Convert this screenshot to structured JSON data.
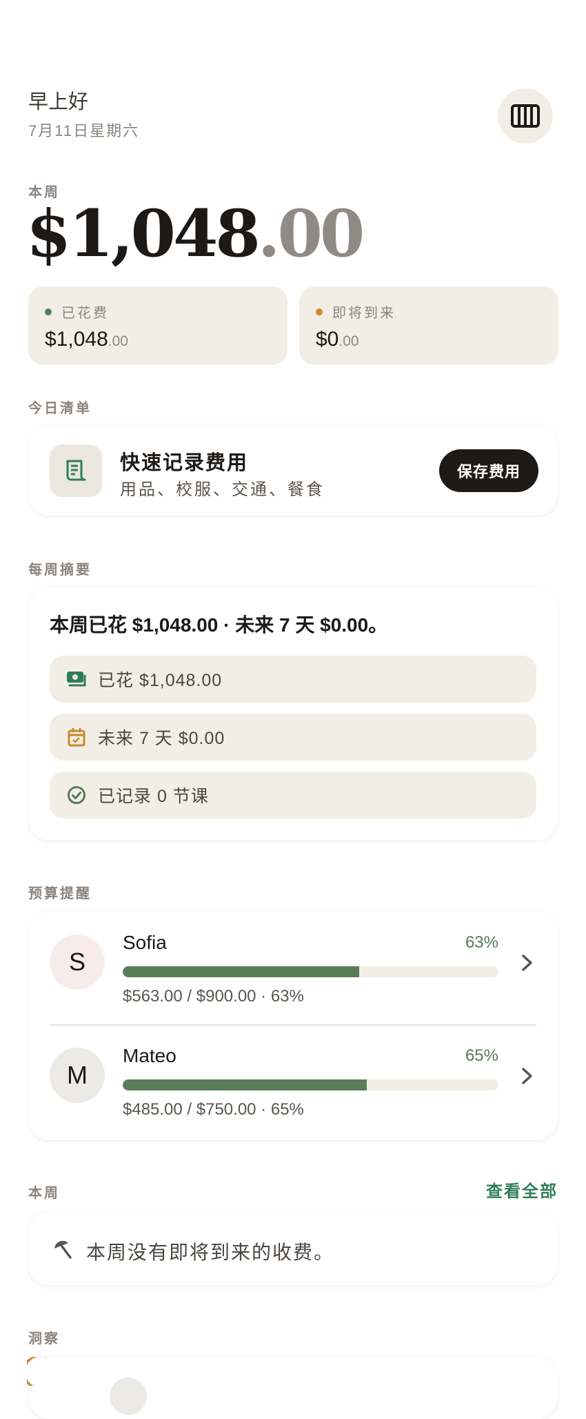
{
  "header": {
    "greeting": "早上好",
    "date": "7月11日星期六",
    "menu_icon": "columns-icon"
  },
  "week": {
    "label": "本周",
    "amount_main": "$1,048",
    "amount_cents": ".00"
  },
  "stats": {
    "spent": {
      "label": "已花费",
      "main": "$1,048",
      "cents": ".00",
      "dot_color": "#5a7d59"
    },
    "upcoming": {
      "label": "即将到来",
      "main": "$0",
      "cents": ".00",
      "dot_color": "#c98a2b"
    }
  },
  "today": {
    "section_label": "今日清单",
    "title": "快速记录费用",
    "subtitle": "用品、校服、交通、餐食",
    "button": "保存费用",
    "icon": "receipt-icon"
  },
  "summary": {
    "section_label": "每周摘要",
    "headline": "本周已花 $1,048.00 · 未来 7 天 $0.00。",
    "items": [
      {
        "icon": "cash-icon",
        "text": "已花 $1,048.00",
        "color": "#2e7d5b"
      },
      {
        "icon": "calendar-check-icon",
        "text": "未来 7 天 $0.00",
        "color": "#c98a2b"
      },
      {
        "icon": "check-circle-icon",
        "text": "已记录 0 节课",
        "color": "#567a56"
      }
    ]
  },
  "budget": {
    "section_label": "预算提醒",
    "rows": [
      {
        "initial": "S",
        "name": "Sofia",
        "pct": "63%",
        "progress": 0.63,
        "detail": "$563.00 / $900.00 · 63%",
        "avatar_bg": "#f8ecea"
      },
      {
        "initial": "M",
        "name": "Mateo",
        "pct": "65%",
        "progress": 0.65,
        "detail": "$485.00 / $750.00 · 65%",
        "avatar_bg": "#ebeae5"
      }
    ]
  },
  "this_week": {
    "section_label": "本周",
    "view_all": "查看全部",
    "empty_text": "本周没有即将到来的收费。",
    "icon": "beach-umbrella-icon"
  },
  "insights": {
    "section_label": "洞察"
  },
  "colors": {
    "accent_green": "#2e7d5b",
    "progress_green": "#5a7d59",
    "warm_bg": "#f2eee6",
    "dark": "#1c1916"
  }
}
